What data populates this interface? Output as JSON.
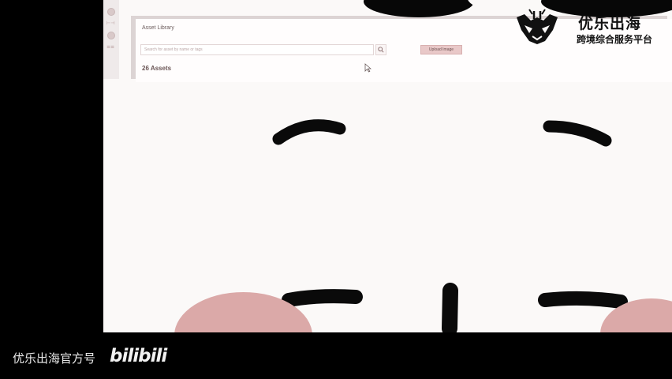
{
  "app": {
    "title": "Asset Library",
    "search": {
      "placeholder": "Search for asset by name or tags"
    },
    "upload_label": "Upload Image",
    "asset_count": "26 Assets",
    "rail": {
      "link1": "⊢⊣",
      "link2": "≡≡"
    }
  },
  "overlay": {
    "logo_title": "优乐出海",
    "logo_subtitle": "跨境综合服务平台",
    "caption": "优乐出海官方号",
    "platform": "bilibili"
  },
  "colors": {
    "background": "#000000",
    "video_bg": "#fbf9f8",
    "accent_pink": "#dba9a8",
    "blob": "#070707"
  },
  "icons": [
    "search-icon",
    "cursor-icon",
    "logo-lion-icon"
  ]
}
